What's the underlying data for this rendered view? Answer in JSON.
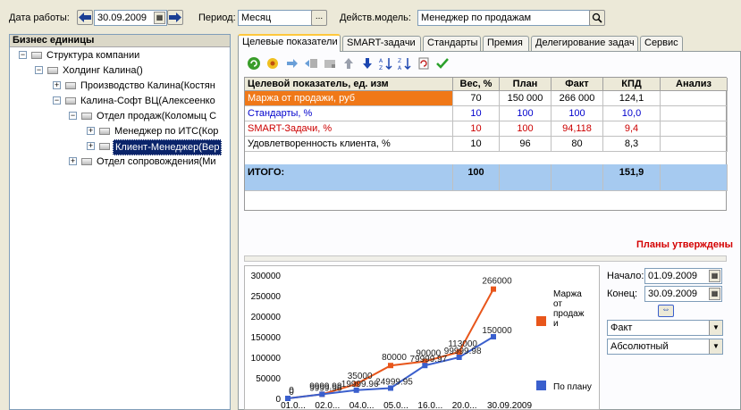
{
  "topbar": {
    "date_label": "Дата работы:",
    "date_value": "30.09.2009",
    "period_label": "Период:",
    "period_value": "Месяц",
    "period_btn": "...",
    "model_label": "Действ.модель:",
    "model_value": "Менеджер по продажам"
  },
  "tree": {
    "header": "Бизнес единицы",
    "nodes": [
      {
        "label": "Структура компании",
        "expander": "−"
      },
      {
        "label": "Холдинг Калина()",
        "expander": "−"
      },
      {
        "label": "Производство Калина(Костян",
        "expander": "+"
      },
      {
        "label": "Калина-Софт ВЦ(Алексеенко",
        "expander": "−"
      },
      {
        "label": "Отдел продаж(Коломыц С",
        "expander": "−"
      },
      {
        "label": "Менеджер по ИТС(Кор",
        "expander": "+"
      },
      {
        "label": "Клиент-Менеджер(Вер",
        "expander": "+"
      },
      {
        "label": "Отдел сопровождения(Ми",
        "expander": "+"
      }
    ]
  },
  "tabs": [
    "Целевые показатели",
    "SMART-задачи",
    "Стандарты",
    "Премия",
    "Делегирование задач",
    "Сервис"
  ],
  "grid": {
    "headers": [
      "Целевой показатель, ед. изм",
      "Вес, %",
      "План",
      "Факт",
      "КПД",
      "Анализ"
    ],
    "rows": [
      {
        "name": "Маржа от продажи, руб",
        "weight": "70",
        "plan": "150 000",
        "fact": "266 000",
        "kpd": "124,1"
      },
      {
        "name": "Стандарты, %",
        "weight": "10",
        "plan": "100",
        "fact": "100",
        "kpd": "10,0"
      },
      {
        "name": "SMART-Задачи, %",
        "weight": "10",
        "plan": "100",
        "fact": "94,118",
        "kpd": "9,4"
      },
      {
        "name": "Удовлетворенность клиента, %",
        "weight": "10",
        "plan": "96",
        "fact": "80",
        "kpd": "8,3"
      }
    ],
    "total": {
      "name": "ИТОГО:",
      "weight": "100",
      "kpd": "151,9"
    }
  },
  "status_text": "Планы утверждены",
  "controls": {
    "start_label": "Начало:",
    "start_value": "01.09.2009",
    "end_label": "Конец:",
    "end_value": "30.09.2009",
    "combo1": "Факт",
    "combo2": "Абсолютный"
  },
  "colors": {
    "orange": "#e8561b",
    "blue": "#3a5fcd",
    "selected": "#0a246a",
    "row_highlight": "#f07818",
    "row_blue_text": "#0000cc",
    "row_red_text": "#cc0000"
  },
  "chart_data": {
    "type": "line",
    "ylim": [
      0,
      300000
    ],
    "yticks": [
      "300000",
      "250000",
      "200000",
      "150000",
      "100000",
      "50000",
      "0"
    ],
    "xticks": [
      "01.0...",
      "02.0...",
      "04.0...",
      "05.0...",
      "16.0...",
      "20.0...",
      "30.09.2009"
    ],
    "series": [
      {
        "name": "Маржа от продажи",
        "legend_lines": [
          "Маржа",
          "от",
          "продаж",
          "и"
        ],
        "color": "#e8561b",
        "x": [
          0,
          1,
          2,
          3,
          4,
          5,
          6
        ],
        "values": [
          0,
          9999.98,
          35000,
          80000,
          90000,
          113000,
          266000
        ],
        "labels": [
          "0",
          "9999.98",
          "35000",
          "80000",
          "90000",
          "113000",
          "266000"
        ]
      },
      {
        "name": "По плану",
        "legend_lines": [
          "По плану"
        ],
        "color": "#3a5fcd",
        "x": [
          0,
          1,
          2,
          3,
          4,
          5,
          6
        ],
        "values": [
          0,
          9999.98,
          19999.96,
          24999.95,
          79999.97,
          99999.98,
          150000
        ],
        "labels": [
          "0",
          "9999.98",
          "19999.96",
          "24999.95",
          "79999.97",
          "99999.98",
          "150000"
        ]
      }
    ]
  }
}
